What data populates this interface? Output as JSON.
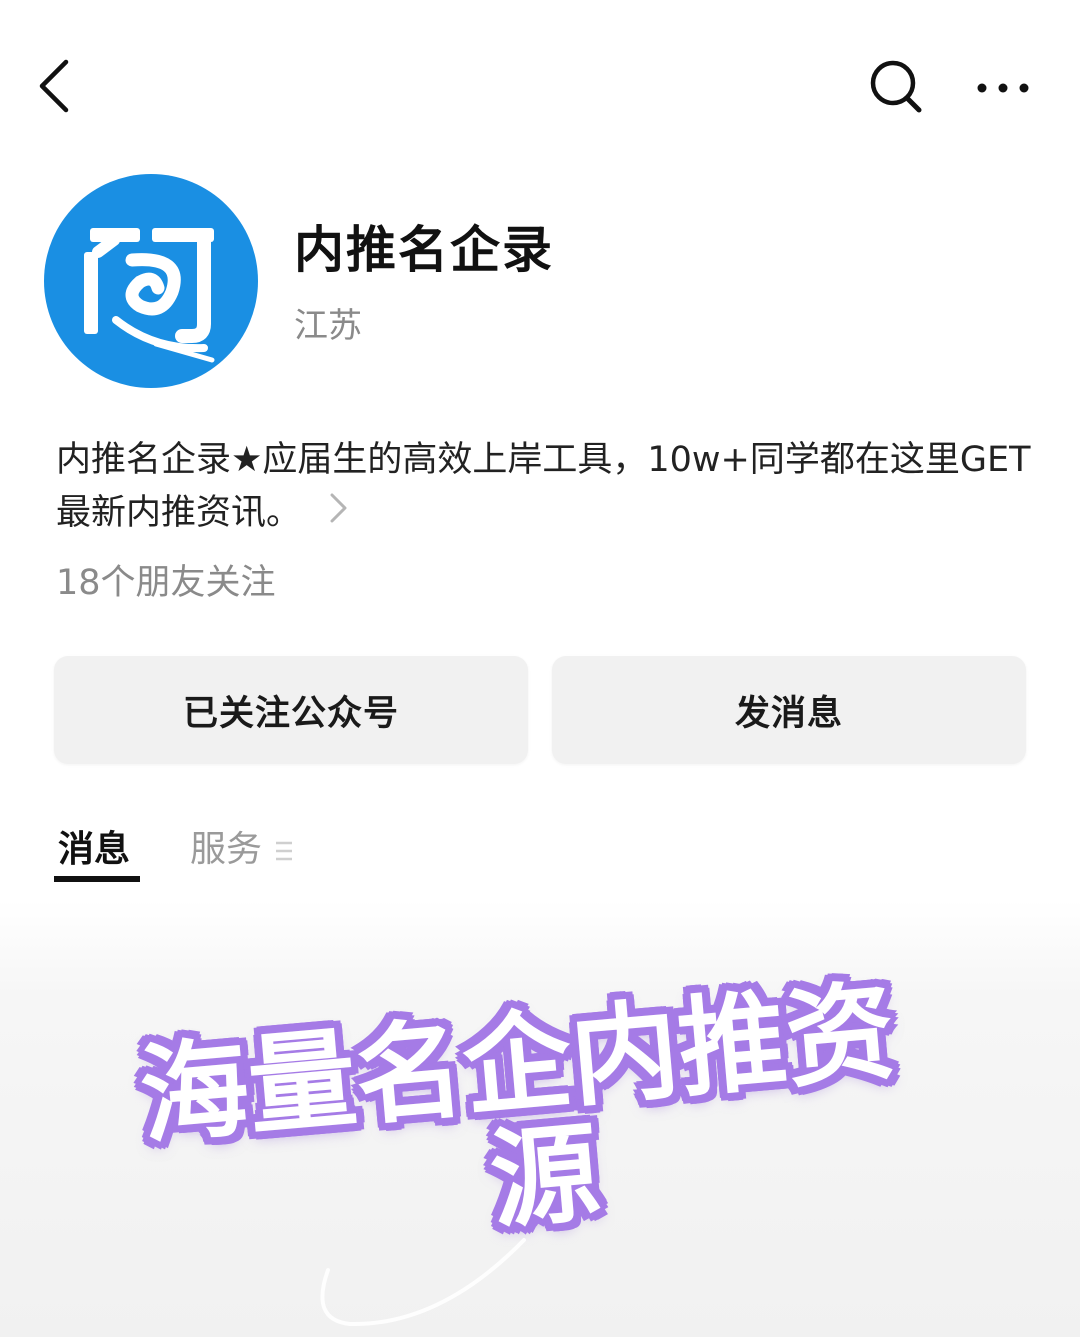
{
  "account": {
    "name": "内推名企录",
    "region": "江苏",
    "description": "内推名企录★应届生的高效上岸工具，10w+同学都在这里GET最新内推资讯。",
    "followers_text": "18个朋友关注"
  },
  "actions": {
    "follow_label": "已关注公众号",
    "message_label": "发消息"
  },
  "tabs": [
    {
      "label": "消息",
      "active": true
    },
    {
      "label": "服务",
      "active": false
    }
  ],
  "overlay": {
    "line1": "海量名企内推资",
    "line2": "源"
  },
  "colors": {
    "avatar_blue": "#1a8fe3",
    "overlay_outline": "#a57be6",
    "button_bg": "#f1f1f1",
    "secondary_text": "#8a8a8a"
  },
  "icons": {
    "back": "chevron-left-icon",
    "search": "search-icon",
    "more": "more-dots-icon",
    "description_more": "chevron-right-icon",
    "services_menu": "menu-lines-icon"
  }
}
